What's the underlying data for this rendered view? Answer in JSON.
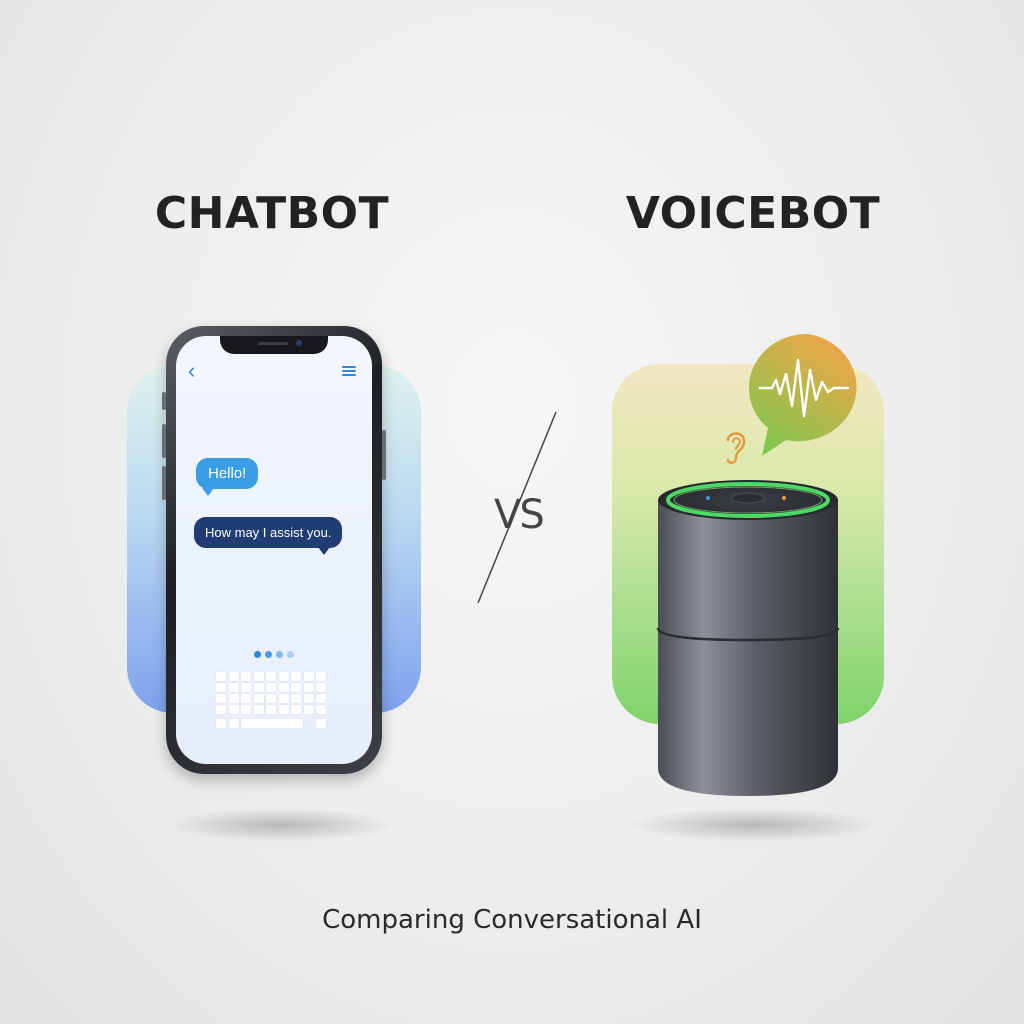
{
  "chatbot": {
    "title": "CHATBOT",
    "messages": {
      "greeting": "Hello!",
      "reply": "How may I assist you."
    },
    "icons": {
      "back": "chevron-left-icon",
      "menu": "menu-icon"
    },
    "colors": {
      "bubble_light": "#3a9de6",
      "bubble_dark": "#1f3d72",
      "accent": "#3a86d6"
    }
  },
  "vs_text": "VS",
  "voicebot": {
    "title": "VOICEBOT",
    "icons": {
      "waveform": "sound-wave-icon",
      "ear": "ear-icon",
      "speech": "speech-bubble-waveform-icon",
      "device": "smart-speaker"
    },
    "colors": {
      "ring": "#4cd964",
      "glow_top": "#f3e7c3",
      "glow_bottom": "#7fd36c"
    }
  },
  "caption": "Comparing Conversational AI"
}
